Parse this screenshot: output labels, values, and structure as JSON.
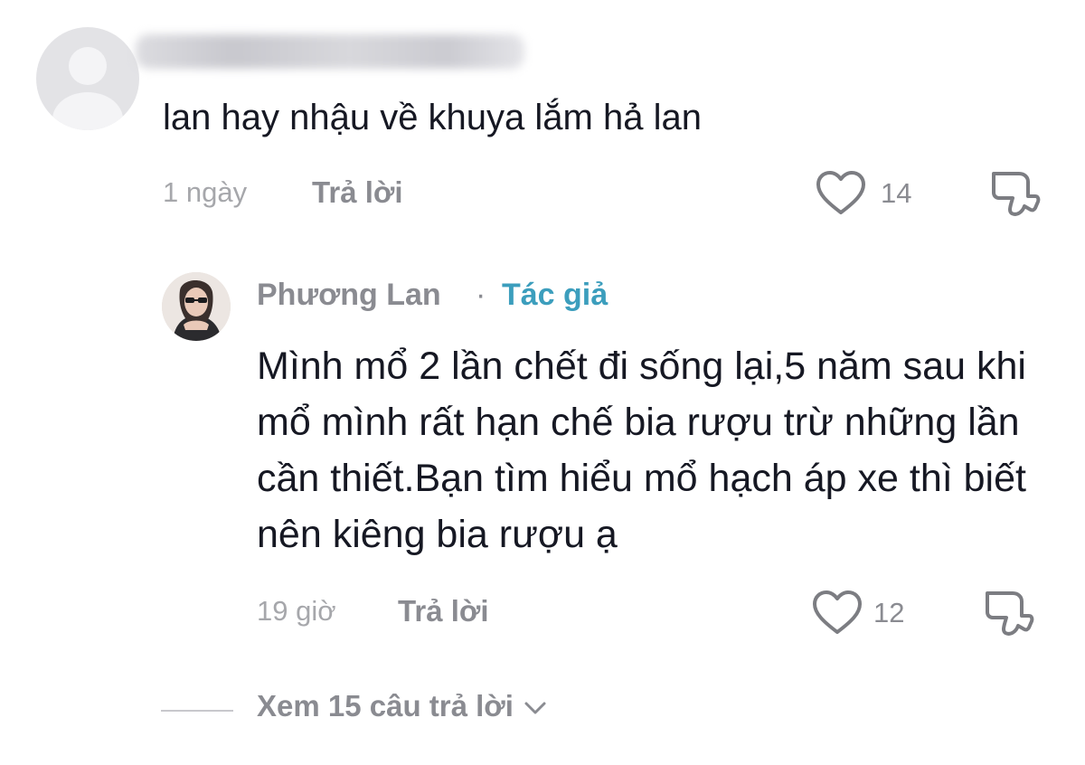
{
  "comment": {
    "text": "lan hay nhậu về khuya lắm hả lan",
    "time": "1 ngày",
    "reply_label": "Trả lời",
    "likes": "14"
  },
  "reply": {
    "author": "Phương Lan",
    "separator": "·",
    "author_badge": "Tác giả",
    "text": "Mình mổ 2 lần chết đi sống lại,5 năm sau khi mổ mình rất hạn chế bia rượu trừ những lần cần thiết.Bạn tìm hiểu mổ hạch áp xe thì biết nên kiêng bia rượu ạ",
    "time": "19 giờ",
    "reply_label": "Trả lời",
    "likes": "12"
  },
  "view_replies": {
    "label": "Xem 15 câu trả lời"
  },
  "icons": {
    "like": "heart-outline-icon",
    "dislike": "thumbs-down-icon",
    "expand": "chevron-down-icon"
  },
  "colors": {
    "text": "#161823",
    "muted": "#8a8b91",
    "author_badge": "#3c9ebd"
  }
}
